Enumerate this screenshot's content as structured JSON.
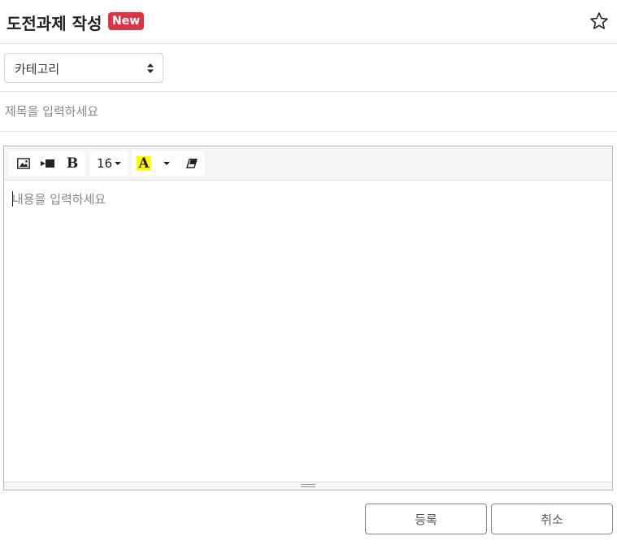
{
  "header": {
    "title": "도전과제 작성",
    "badge": "New",
    "star_icon": "star-outline-icon"
  },
  "category": {
    "selected": "카테고리"
  },
  "title_field": {
    "value": "",
    "placeholder": "제목을 입력하세요"
  },
  "editor": {
    "toolbar": {
      "image_icon": "image-icon",
      "video_icon": "video-icon",
      "bold_label": "B",
      "font_size": "16",
      "color_label": "A",
      "highlight_color": "#ffff00",
      "eraser_icon": "eraser-icon"
    },
    "placeholder": "내용을 입력하세요"
  },
  "actions": {
    "submit_label": "등록",
    "cancel_label": "취소"
  },
  "colors": {
    "badge": "#dc3545"
  }
}
